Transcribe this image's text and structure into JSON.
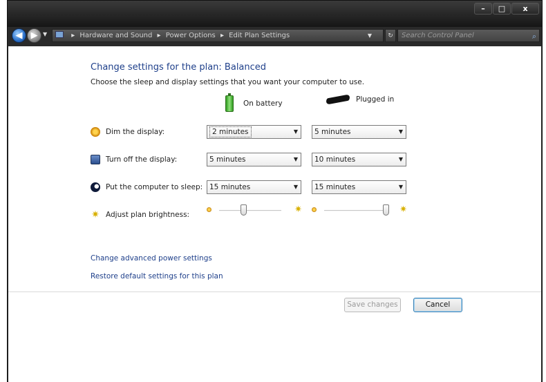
{
  "window": {
    "controls": {
      "minimize": "–",
      "maximize": "□",
      "close": "x"
    }
  },
  "navbar": {
    "back_icon": "back-arrow-icon",
    "forward_icon": "forward-arrow-icon",
    "breadcrumb": [
      "Hardware and Sound",
      "Power Options",
      "Edit Plan Settings"
    ],
    "breadcrumb_separator": "▸",
    "search_placeholder": "Search Control Panel"
  },
  "page": {
    "title": "Change settings for the plan: Balanced",
    "subtitle": "Choose the sleep and display settings that you want your computer to use.",
    "columns": {
      "battery": "On battery",
      "plugged": "Plugged in"
    },
    "settings": [
      {
        "label": "Dim the display:",
        "icon": "dim-display-icon",
        "battery": "2 minutes",
        "plugged": "5 minutes"
      },
      {
        "label": "Turn off the display:",
        "icon": "display-off-icon",
        "battery": "5 minutes",
        "plugged": "10 minutes"
      },
      {
        "label": "Put the computer to sleep:",
        "icon": "sleep-icon",
        "battery": "15 minutes",
        "plugged": "15 minutes"
      }
    ],
    "brightness": {
      "label": "Adjust plan brightness:",
      "battery_level": 0.4,
      "plugged_level": 1.0
    },
    "links": {
      "advanced": "Change advanced power settings",
      "restore": "Restore default settings for this plan"
    },
    "buttons": {
      "save": "Save changes",
      "cancel": "Cancel"
    }
  },
  "colors": {
    "link": "#1e3f8a",
    "heading": "#1e3f8a",
    "titlebar": "#161616"
  }
}
